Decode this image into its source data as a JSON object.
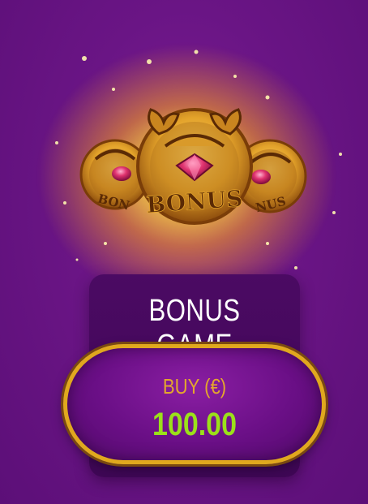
{
  "bonus_panel": {
    "title": "BONUS GAME",
    "buy_label": "BUY (€)",
    "price": "100.00"
  },
  "coins": {
    "label": "BONUS",
    "icons": [
      "crab-coin-icon",
      "ruby-gem-icon"
    ],
    "colors": {
      "gold": "#e3a22a",
      "gem": "#e0336f",
      "background": "#6a1585",
      "price": "#9be01a",
      "buy_label": "#e4a72c"
    }
  }
}
